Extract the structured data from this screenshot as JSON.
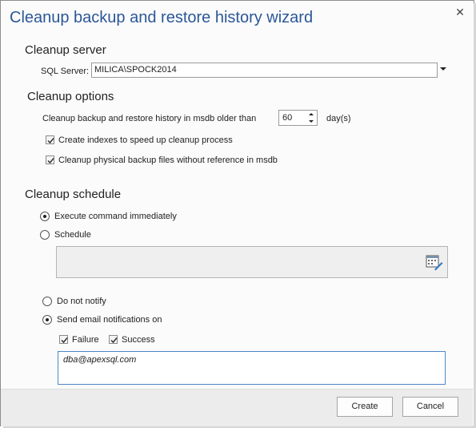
{
  "window": {
    "title": "Cleanup backup and restore history wizard",
    "close_glyph": "✕"
  },
  "cleanup_server": {
    "heading": "Cleanup server",
    "sql_server_label": "SQL Server:",
    "sql_server_value": "MILICA\\SPOCK2014"
  },
  "cleanup_options": {
    "heading": "Cleanup options",
    "older_than_label": "Cleanup backup and restore history in msdb older than",
    "days_value": "60",
    "days_unit": "day(s)",
    "create_indexes_label": "Create indexes to speed up cleanup process",
    "create_indexes_checked": true,
    "cleanup_files_label": "Cleanup physical backup files without reference in msdb",
    "cleanup_files_checked": true
  },
  "cleanup_schedule": {
    "heading": "Cleanup schedule",
    "execute_now_label": "Execute command immediately",
    "execute_now_selected": true,
    "schedule_label": "Schedule",
    "schedule_selected": false,
    "schedule_icon": "schedule-editor-icon"
  },
  "notifications": {
    "do_not_notify_label": "Do not notify",
    "do_not_notify_selected": false,
    "send_email_label": "Send email notifications on",
    "send_email_selected": true,
    "failure_label": "Failure",
    "failure_checked": true,
    "success_label": "Success",
    "success_checked": true,
    "email_value": "dba@apexsql.com"
  },
  "footer": {
    "create_label": "Create",
    "cancel_label": "Cancel"
  },
  "colors": {
    "title": "#2b5797",
    "accent_border": "#4f86c6",
    "footer_bg": "#ececec"
  }
}
